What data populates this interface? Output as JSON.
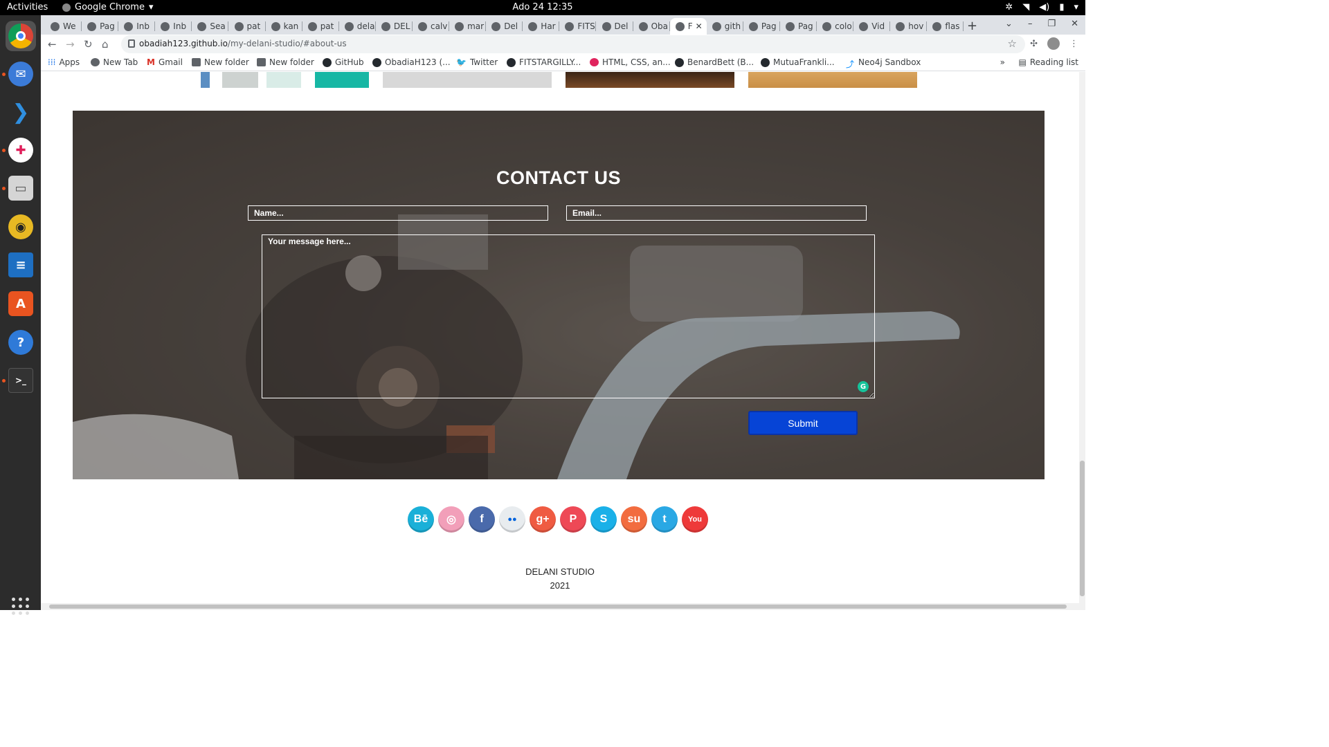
{
  "system": {
    "activities": "Activities",
    "app_name": "Google Chrome",
    "clock": "Ado 24  12:35"
  },
  "dock": {
    "apps": [
      "chrome-icon",
      "thunderbird-icon",
      "vscode-icon",
      "slack-icon",
      "files-icon",
      "rhythmbox-icon",
      "writer-icon",
      "software-icon",
      "help-icon",
      "terminal-icon"
    ]
  },
  "tabs": [
    {
      "label": "We"
    },
    {
      "label": "Pag"
    },
    {
      "label": "Inb"
    },
    {
      "label": "Inb"
    },
    {
      "label": "Sea"
    },
    {
      "label": "pat"
    },
    {
      "label": "kan"
    },
    {
      "label": "pat"
    },
    {
      "label": "dela"
    },
    {
      "label": "DEL"
    },
    {
      "label": "calv"
    },
    {
      "label": "mar"
    },
    {
      "label": "Del"
    },
    {
      "label": "Har"
    },
    {
      "label": "FITS"
    },
    {
      "label": "Del"
    },
    {
      "label": "Oba"
    },
    {
      "label": "F"
    },
    {
      "label": "gith"
    },
    {
      "label": "Pag"
    },
    {
      "label": "Pag"
    },
    {
      "label": "colo"
    },
    {
      "label": "Vid"
    },
    {
      "label": "hov"
    },
    {
      "label": "flas"
    }
  ],
  "active_tab_index": 17,
  "address": {
    "host": "obadiah123.github.io",
    "path": "/my-delani-studio/#about-us"
  },
  "bookmarks": {
    "apps": "Apps",
    "items": [
      "New Tab",
      "Gmail",
      "New folder",
      "New folder",
      "GitHub",
      "ObadiaH123 (...",
      "Twitter",
      "FITSTARGILLY...",
      "HTML, CSS, an...",
      "BenardBett (B...",
      "MutuaFrankli...",
      "Neo4j Sandbox"
    ],
    "reading_list": "Reading list"
  },
  "contact": {
    "title": "CONTACT US",
    "name_placeholder": "Name...",
    "email_placeholder": "Email...",
    "message_placeholder": "Your message here...",
    "submit_label": "Submit"
  },
  "social": [
    {
      "icon": "behance-icon",
      "glyph": "Bē",
      "color": "#1ab0d8"
    },
    {
      "icon": "dribbble-icon",
      "glyph": "◎",
      "color": "#f29fb9"
    },
    {
      "icon": "facebook-icon",
      "glyph": "f",
      "color": "#4a6aab"
    },
    {
      "icon": "flickr-icon",
      "glyph": "●●",
      "color": "#e8ecef"
    },
    {
      "icon": "google-plus-icon",
      "glyph": "g+",
      "color": "#ef5b42"
    },
    {
      "icon": "pinterest-icon",
      "glyph": "P",
      "color": "#ee4956"
    },
    {
      "icon": "skype-icon",
      "glyph": "S",
      "color": "#1ab0e8"
    },
    {
      "icon": "stumbleupon-icon",
      "glyph": "su",
      "color": "#f26c3f"
    },
    {
      "icon": "twitter-icon",
      "glyph": "t",
      "color": "#2aa8e4"
    },
    {
      "icon": "youtube-icon",
      "glyph": "You",
      "color": "#ee3a3a"
    }
  ],
  "footer": {
    "studio": "DELANI STUDIO",
    "year": "2021"
  }
}
